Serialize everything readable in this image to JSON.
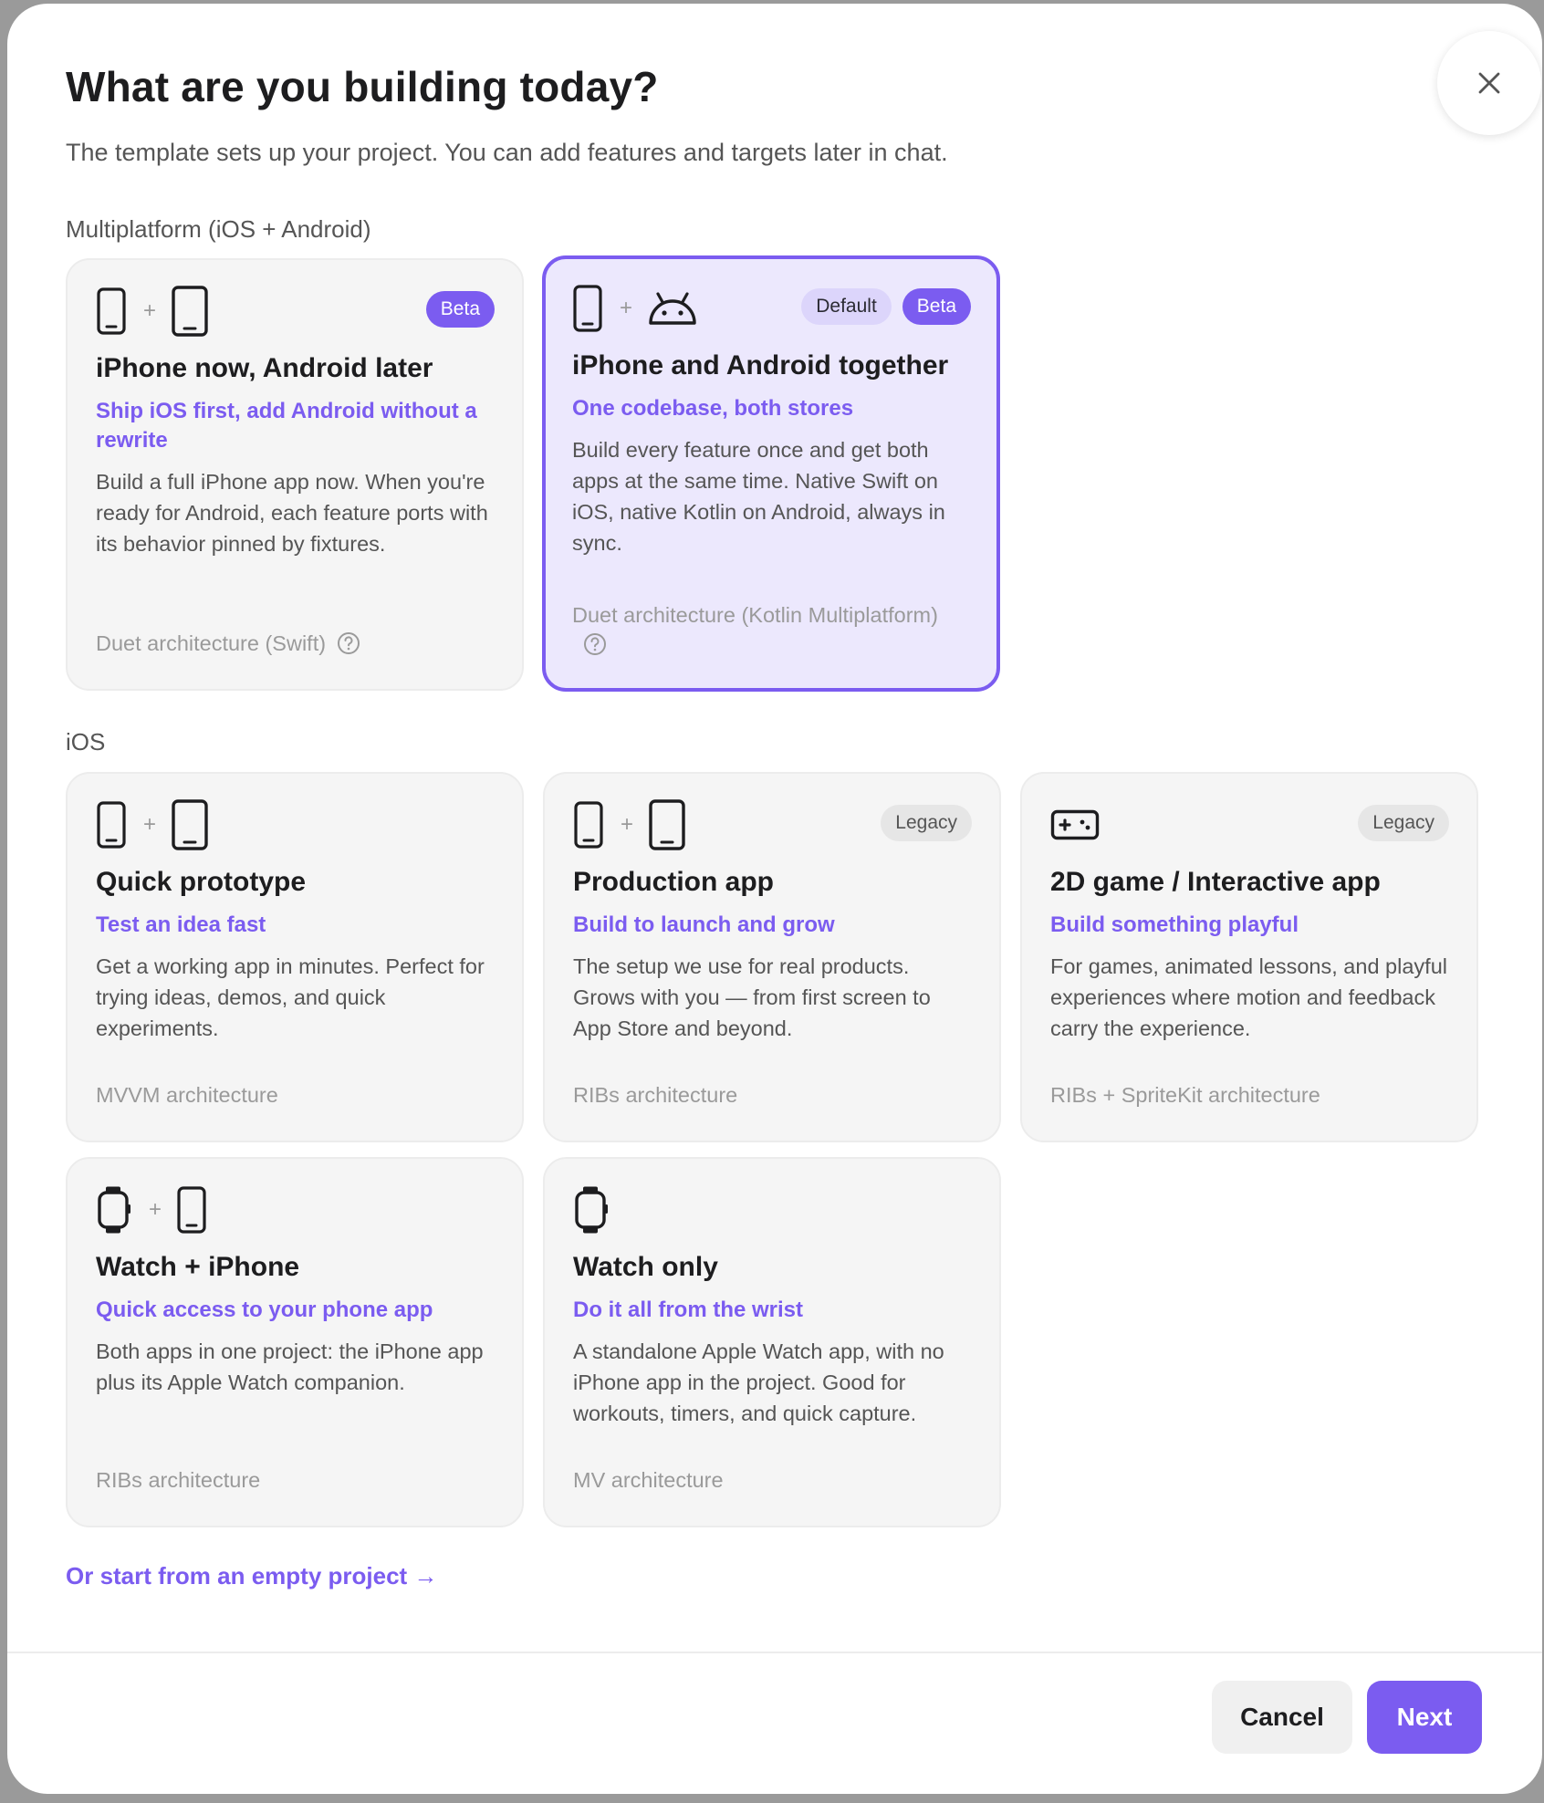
{
  "dialog": {
    "title": "What are you building today?",
    "subtitle": "The template sets up your project. You can add features and targets later in chat."
  },
  "sections": [
    {
      "label": "Multiplatform (iOS + Android)",
      "cards": [
        {
          "icons": [
            "iphone-icon",
            "plus",
            "ipad-icon"
          ],
          "badges": [
            "Beta"
          ],
          "title": "iPhone now, Android later",
          "tagline": "Ship iOS first, add Android without a rewrite",
          "description": "Build a full iPhone app now. When you're ready for Android, each feature ports with its behavior pinned by fixtures.",
          "architecture": "Duet architecture (Swift)",
          "selected": false
        },
        {
          "icons": [
            "iphone-icon",
            "plus",
            "android-icon"
          ],
          "badges": [
            "Default",
            "Beta"
          ],
          "title": "iPhone and Android together",
          "tagline": "One codebase, both stores",
          "description": "Build every feature once and get both apps at the same time. Native Swift on iOS, native Kotlin on Android, always in sync.",
          "architecture": "Duet architecture (Kotlin Multiplatform)",
          "selected": true
        }
      ]
    },
    {
      "label": "iOS",
      "cards": [
        {
          "icons": [
            "iphone-icon",
            "plus",
            "ipad-icon"
          ],
          "badges": [],
          "title": "Quick prototype",
          "tagline": "Test an idea fast",
          "description": "Get a working app in minutes. Perfect for trying ideas, demos, and quick experiments.",
          "architecture": "MVVM architecture"
        },
        {
          "icons": [
            "iphone-icon",
            "plus",
            "ipad-icon"
          ],
          "badges": [
            "Legacy"
          ],
          "title": "Production app",
          "tagline": "Build to launch and grow",
          "description": "The setup we use for real products. Grows with you — from first screen to App Store and beyond.",
          "architecture": "RIBs architecture"
        },
        {
          "icons": [
            "gamepad-icon"
          ],
          "badges": [
            "Legacy"
          ],
          "title": "2D game / Interactive app",
          "tagline": "Build something playful",
          "description": "For games, animated lessons, and playful experiences where motion and feedback carry the experience.",
          "architecture": "RIBs + SpriteKit architecture"
        },
        {
          "icons": [
            "watch-icon",
            "plus",
            "iphone-icon"
          ],
          "badges": [],
          "title": "Watch + iPhone",
          "tagline": "Quick access to your phone app",
          "description": "Both apps in one project: the iPhone app plus its Apple Watch companion.",
          "architecture": "RIBs architecture"
        },
        {
          "icons": [
            "watch-icon"
          ],
          "badges": [],
          "title": "Watch only",
          "tagline": "Do it all from the wrist",
          "description": "A standalone Apple Watch app, with no iPhone app in the project. Good for workouts, timers, and quick capture.",
          "architecture": "MV architecture"
        }
      ]
    }
  ],
  "plus_glyph": "+",
  "empty_project_link": "Or start from an empty project →",
  "buttons": {
    "cancel": "Cancel",
    "next": "Next"
  },
  "colors": {
    "accent": "#7b5cf0",
    "selected_bg": "#ece8fd",
    "card_bg": "#f5f5f5"
  }
}
